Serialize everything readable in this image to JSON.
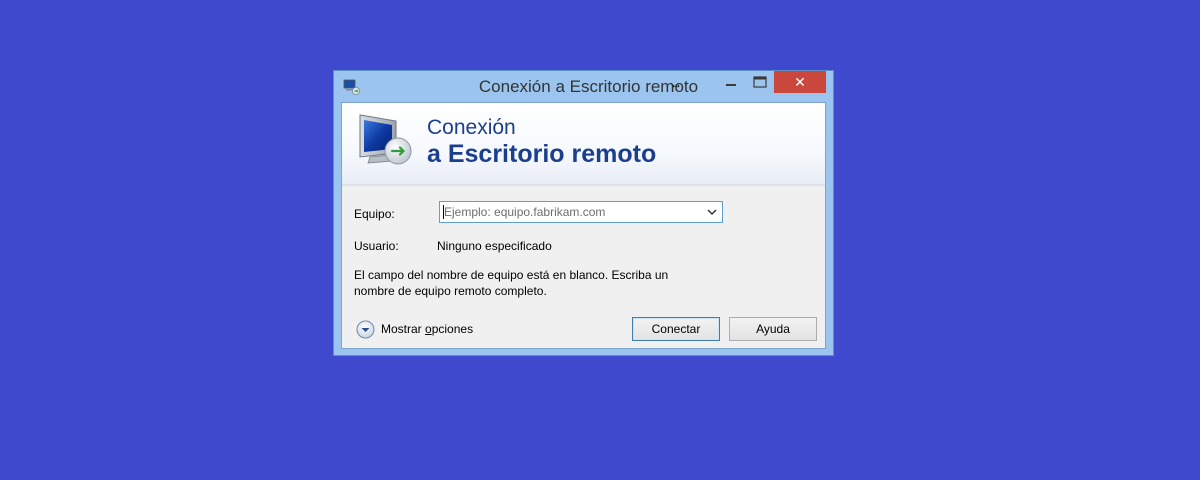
{
  "window": {
    "title": "Conexión a Escritorio remoto",
    "close_glyph": "✕",
    "resize_cursor_glyph": "↔"
  },
  "banner": {
    "line1": "Conexión",
    "line2": "a Escritorio remoto"
  },
  "form": {
    "computer_label": "Equipo:",
    "computer_value": "",
    "computer_placeholder": "Ejemplo: equipo.fabrikam.com",
    "user_label": "Usuario:",
    "user_value": "Ninguno especificado",
    "message_line1": "El campo del nombre de equipo está en blanco. Escriba un",
    "message_line2": "nombre de equipo remoto completo."
  },
  "footer": {
    "options_label_prefix": "Mostrar ",
    "options_label_underlined": "o",
    "options_label_suffix": "pciones",
    "connect_label": "Conectar",
    "help_label": "Ayuda"
  },
  "icons": {
    "app": "remote-desktop-icon",
    "banner": "remote-desktop-monitor-icon",
    "minimize": "minimize-icon",
    "maximize": "maximize-icon",
    "close": "close-icon",
    "dropdown": "chevron-down-icon",
    "options": "expand-circle-icon"
  },
  "colors": {
    "desktop": "#3f49ce",
    "window_frame": "#9bc5ef",
    "close_button": "#c9473d",
    "banner_text": "#1b3e8f"
  }
}
